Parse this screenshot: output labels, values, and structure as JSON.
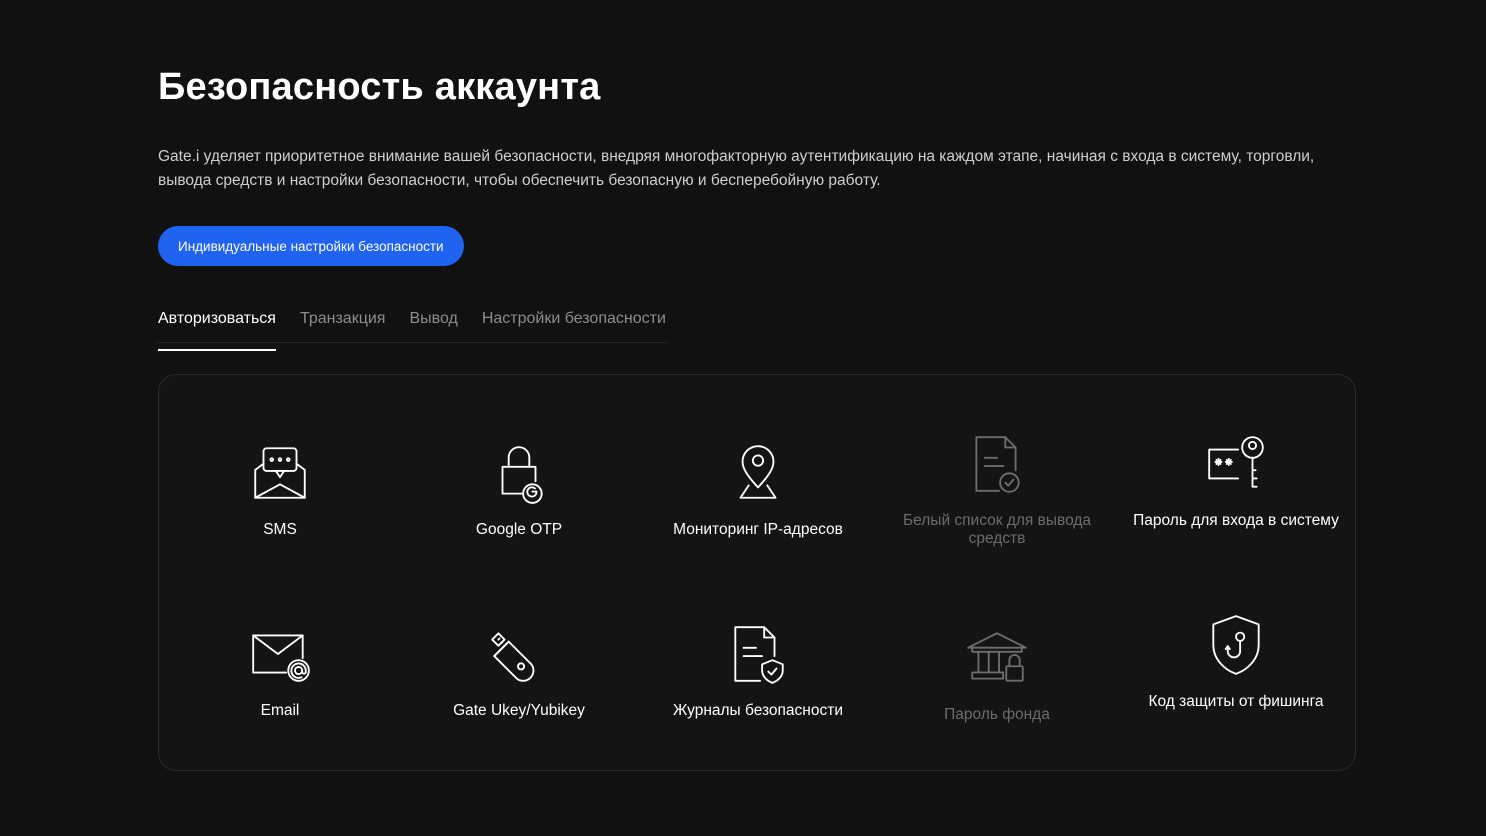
{
  "page": {
    "title": "Безопасность аккаунта",
    "description": "Gate.i уделяет приоритетное внимание вашей безопасности, внедряя многофакторную аутентификацию на каждом этапе, начиная с входа в систему, торговли, вывода средств и настройки безопасности, чтобы обеспечить безопасную и бесперебойную работу.",
    "cta_label": "Индивидуальные настройки безопасности"
  },
  "tabs": [
    {
      "label": "Авторизоваться",
      "active": true
    },
    {
      "label": "Транзакция",
      "active": false
    },
    {
      "label": "Вывод",
      "active": false
    },
    {
      "label": "Настройки безопасности",
      "active": false
    }
  ],
  "features": [
    {
      "label": "SMS",
      "icon": "sms-envelope-icon",
      "disabled": false
    },
    {
      "label": "Google OTP",
      "icon": "google-lock-icon",
      "disabled": false
    },
    {
      "label": "Мониторинг IP-адресов",
      "icon": "location-pin-icon",
      "disabled": false
    },
    {
      "label": "Белый список для вывода средств",
      "icon": "document-check-icon",
      "disabled": true
    },
    {
      "label": "Пароль для входа в систему",
      "icon": "password-key-icon",
      "disabled": false
    },
    {
      "label": "Email",
      "icon": "email-at-icon",
      "disabled": false
    },
    {
      "label": "Gate Ukey/Yubikey",
      "icon": "usb-key-icon",
      "disabled": false
    },
    {
      "label": "Журналы безопасности",
      "icon": "document-shield-icon",
      "disabled": false
    },
    {
      "label": "Пароль фонда",
      "icon": "bank-lock-icon",
      "disabled": true
    },
    {
      "label": "Код защиты от фишинга",
      "icon": "shield-hook-icon",
      "disabled": false
    }
  ],
  "colors": {
    "background": "#111111",
    "accent": "#1f63f0",
    "disabled_text": "#6c6c6c"
  }
}
